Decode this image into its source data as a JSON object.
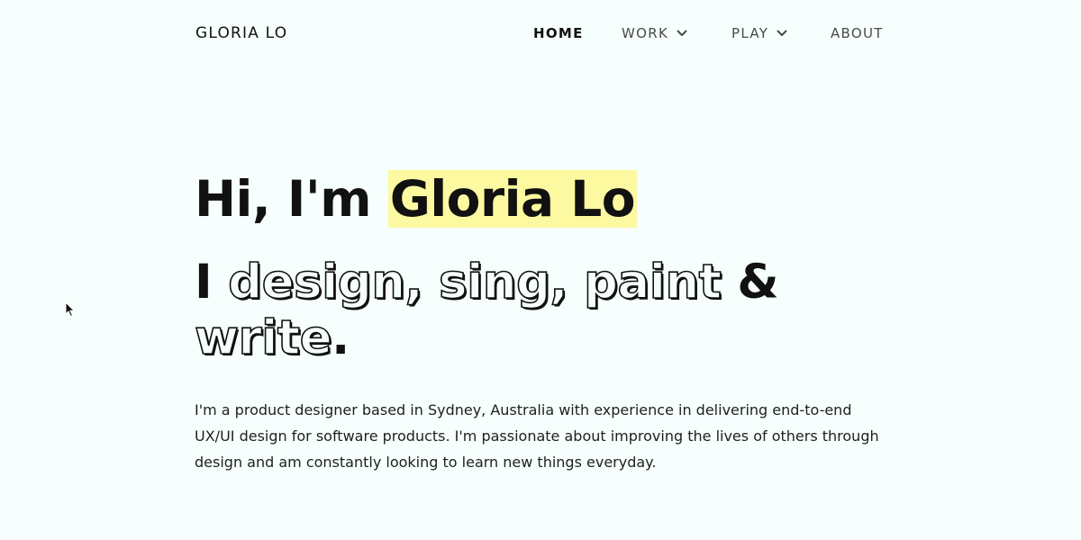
{
  "brand": "GLORIA LO",
  "nav": {
    "home": "HOME",
    "work": "WORK",
    "play": "PLAY",
    "about": "ABOUT"
  },
  "hero": {
    "greeting": "Hi, I'm ",
    "name": "Gloria Lo",
    "sub_prefix": "I ",
    "sub_outline_1": "design, sing, paint",
    "sub_amp": " & ",
    "sub_outline_2": "write",
    "sub_end": "."
  },
  "intro": "I'm a product designer based in Sydney, Australia with experience in delivering end-to-end UX/UI design for software products. I'm passionate about improving the lives of others through design and am constantly looking to learn new things everyday.",
  "colors": {
    "background": "#f6fffd",
    "highlight": "#fdf9a0",
    "text": "#111111",
    "nav_text": "#4a4a4a"
  },
  "icons": {
    "dropdown": "chevron-down-icon",
    "cursor": "mouse-pointer-icon"
  }
}
